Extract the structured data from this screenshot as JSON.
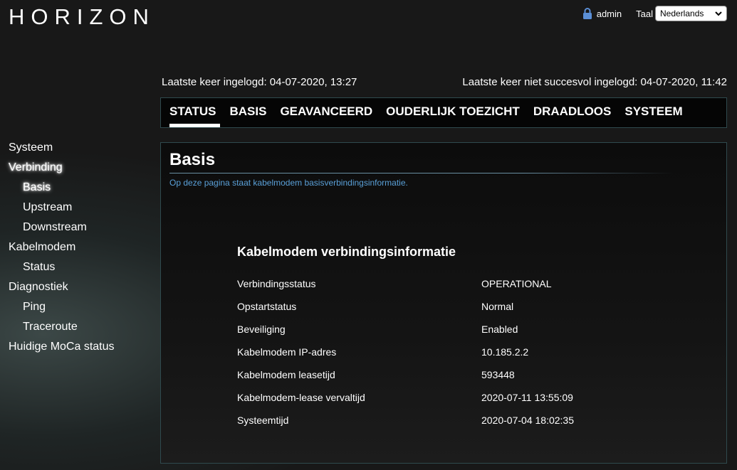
{
  "header": {
    "logo": "HORIZON",
    "user": "admin",
    "lang_label": "Taal",
    "lang_selected": "Nederlands"
  },
  "login": {
    "last_login": "Laatste keer ingelogd: 04-07-2020, 13:27",
    "last_failed": "Laatste keer niet succesvol ingelogd: 04-07-2020, 11:42"
  },
  "tabs": [
    {
      "label": "STATUS",
      "active": true
    },
    {
      "label": "BASIS"
    },
    {
      "label": "GEAVANCEERD"
    },
    {
      "label": "OUDERLIJK TOEZICHT"
    },
    {
      "label": "DRAADLOOS"
    },
    {
      "label": "SYSTEEM"
    }
  ],
  "sidebar": {
    "items": [
      {
        "label": "Systeem"
      },
      {
        "label": "Verbinding",
        "active": true
      },
      {
        "label": "Basis",
        "active": true
      },
      {
        "label": "Upstream"
      },
      {
        "label": "Downstream"
      },
      {
        "label": "Kabelmodem"
      },
      {
        "label": "Status"
      },
      {
        "label": "Diagnostiek"
      },
      {
        "label": "Ping"
      },
      {
        "label": "Traceroute"
      },
      {
        "label": "Huidige MoCa status"
      }
    ]
  },
  "panel": {
    "title": "Basis",
    "description": "Op deze pagina staat kabelmodem basisverbindingsinformatie.",
    "section_title": "Kabelmodem verbindingsinformatie",
    "rows": [
      {
        "label": "Verbindingsstatus",
        "value": "OPERATIONAL"
      },
      {
        "label": "Opstartstatus",
        "value": "Normal"
      },
      {
        "label": "Beveiliging",
        "value": "Enabled"
      },
      {
        "label": "Kabelmodem IP-adres",
        "value": "10.185.2.2"
      },
      {
        "label": "Kabelmodem leasetijd",
        "value": "593448"
      },
      {
        "label": "Kabelmodem-lease vervaltijd",
        "value": "2020-07-11 13:55:09"
      },
      {
        "label": "Systeemtijd",
        "value": "2020-07-04 18:02:35"
      }
    ]
  },
  "colors": {
    "accent_link": "#5aa0d8",
    "border": "#2f4a4e",
    "lock_icon": "#5b8fd6"
  }
}
